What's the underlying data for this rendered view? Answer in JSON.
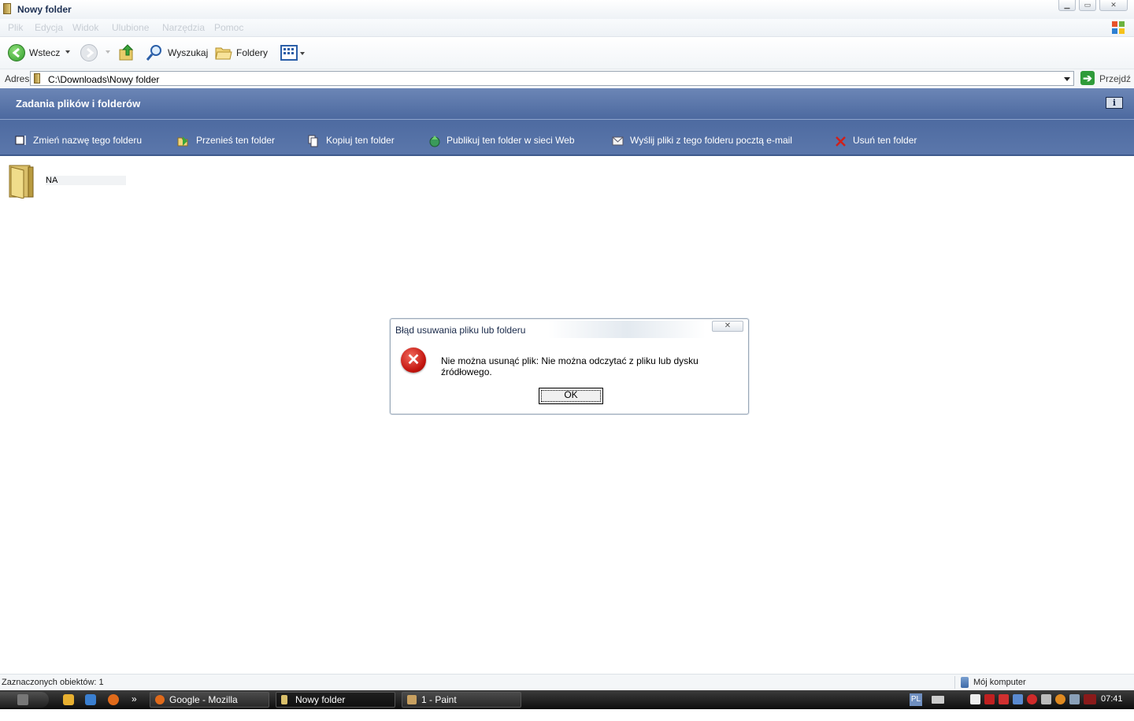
{
  "window": {
    "title": "Nowy folder"
  },
  "menu": {
    "items": [
      "Plik",
      "Edycja",
      "Widok",
      "Ulubione",
      "Narzędzia",
      "Pomoc"
    ]
  },
  "toolbar": {
    "back_label": "Wstecz",
    "search_label": "Wyszukaj",
    "folders_label": "Foldery"
  },
  "address": {
    "label": "Adres",
    "value": "C:\\Downloads\\Nowy folder",
    "go_label": "Przejdź"
  },
  "tasks": {
    "header": "Zadania plików i folderów",
    "items": [
      {
        "label": "Zmień nazwę tego folderu",
        "icon": "rename-icon"
      },
      {
        "label": "Przenieś ten folder",
        "icon": "move-icon"
      },
      {
        "label": "Kopiuj ten folder",
        "icon": "copy-icon"
      },
      {
        "label": "Publikuj ten folder w sieci Web",
        "icon": "publish-web-icon"
      },
      {
        "label": "Wyślij pliki z tego folderu pocztą e-mail",
        "icon": "email-icon"
      },
      {
        "label": "Usuń ten folder",
        "icon": "delete-icon"
      }
    ]
  },
  "content": {
    "items": [
      {
        "name": "NA",
        "icon": "folder-icon"
      }
    ]
  },
  "dialog": {
    "title": "Błąd usuwania pliku lub folderu",
    "message": "Nie można usunąć plik: Nie można odczytać z pliku lub dysku źródłowego.",
    "ok_label": "OK",
    "close_glyph": "✕"
  },
  "status": {
    "left": "Zaznaczonych obiektów: 1",
    "right": "Mój komputer"
  },
  "taskbar": {
    "tasks": [
      {
        "label": "Google - Mozilla Firefox"
      },
      {
        "label": "Nowy folder"
      },
      {
        "label": "1 - Paint"
      }
    ],
    "chevron": "»",
    "language": "PL",
    "clock": "07:41"
  },
  "colors": {
    "task_panel": "#5670a5",
    "error_red": "#c2140e",
    "taskbar": "#1a1a1a"
  }
}
